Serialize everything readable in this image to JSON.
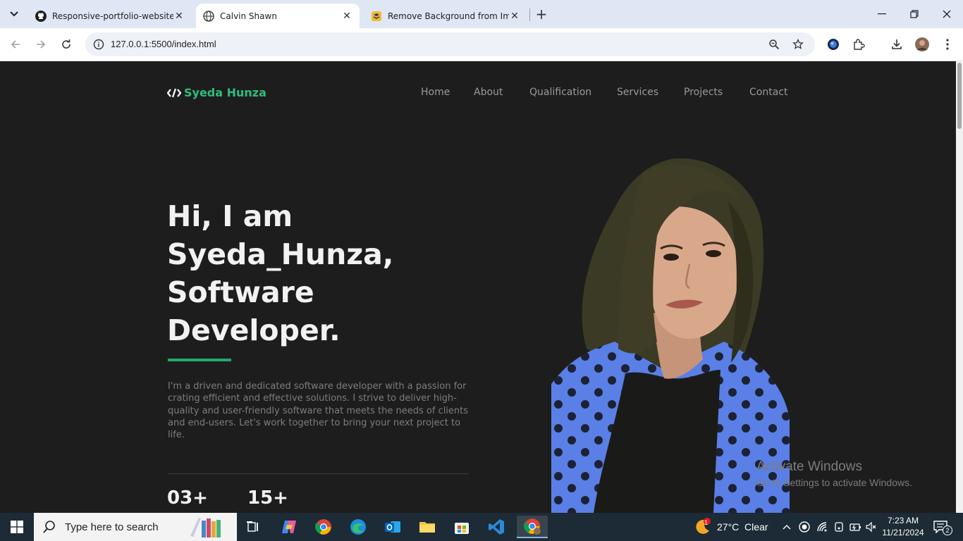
{
  "browser": {
    "tabs": [
      {
        "title": "Responsive-portfolio-website/a",
        "favicon": "github-icon"
      },
      {
        "title": "Calvin Shawn",
        "favicon": "globe-icon",
        "active": true
      },
      {
        "title": "Remove Background from Imag",
        "favicon": "removebg-icon"
      }
    ],
    "url": "127.0.0.1:5500/index.html"
  },
  "site": {
    "logo_text": "Syeda Hunza",
    "nav": [
      "Home",
      "About",
      "Qualification",
      "Services",
      "Projects",
      "Contact"
    ],
    "hero_lines": [
      "Hi, I am",
      "Syeda_Hunza,",
      "Software",
      "Developer."
    ],
    "description": "I'm a driven and dedicated software developer with a passion for crating efficient and effective solutions. I strive to deliver high-quality and user-friendly software that meets the needs of clients and end-users. Let's work together to bring your next project to life.",
    "stats": [
      "03+",
      "15+"
    ],
    "accent_color": "#2dbd7e",
    "background_color": "#1d1d1d"
  },
  "watermark": {
    "title": "Activate Windows",
    "subtitle": "Go to Settings to activate Windows."
  },
  "taskbar": {
    "search_placeholder": "Type here to search",
    "weather": "27°C  Clear",
    "weather_badge": "1",
    "time": "7:23 AM",
    "date": "11/21/2024",
    "notification_count": "2"
  }
}
